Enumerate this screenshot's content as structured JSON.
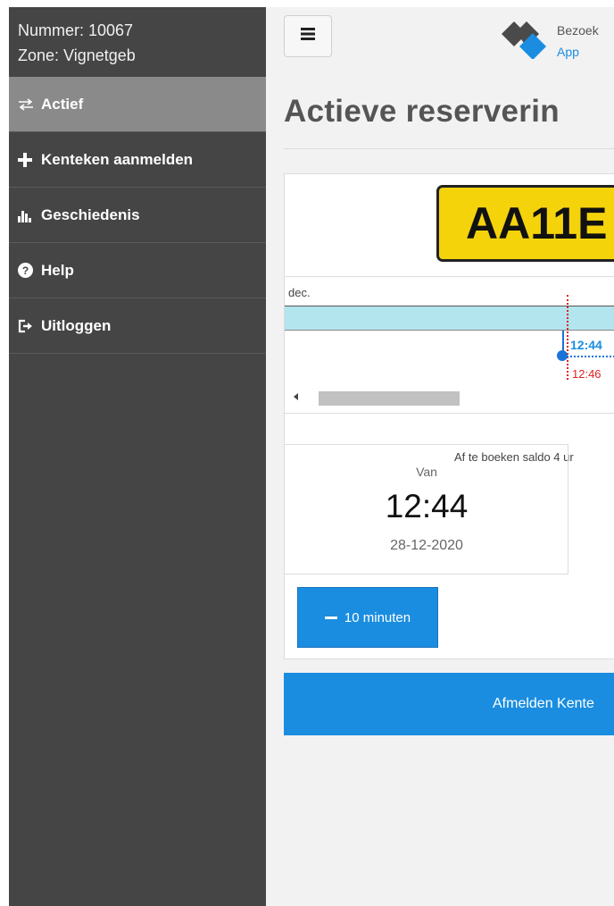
{
  "sidebar": {
    "number_line": "Nummer: 10067",
    "zone_line": "Zone: Vignetgeb",
    "items": [
      {
        "label": "Actief",
        "icon": "exchange-icon",
        "active": true
      },
      {
        "label": "Kenteken aanmelden",
        "icon": "plus-icon"
      },
      {
        "label": "Geschiedenis",
        "icon": "bar-chart-icon"
      },
      {
        "label": "Help",
        "icon": "question-circle-icon"
      },
      {
        "label": "Uitloggen",
        "icon": "sign-out-icon"
      }
    ]
  },
  "header": {
    "menu_icon": "hamburger-icon",
    "logo_text_1": "Bezoek",
    "logo_text_2": "App"
  },
  "main": {
    "page_title": "Actieve reserverin",
    "plate": "AA11E",
    "timeline": {
      "month": "dec.",
      "start_label": "12:44",
      "now_label": "12:46"
    },
    "saldo_text": "Af te boeken saldo 4 ur",
    "van": {
      "label": "Van",
      "time": "12:44",
      "date": "28-12-2020"
    },
    "minus_button": "10 minuten",
    "afmelden_button": "Afmelden Kente"
  },
  "colors": {
    "sidebar_bg": "#454545",
    "active_item_bg": "#8a8a8a",
    "accent_blue": "#1a8de0",
    "plate_yellow": "#f5d30b",
    "timeline_band": "#b3e5ef",
    "now_red": "#e02020"
  }
}
